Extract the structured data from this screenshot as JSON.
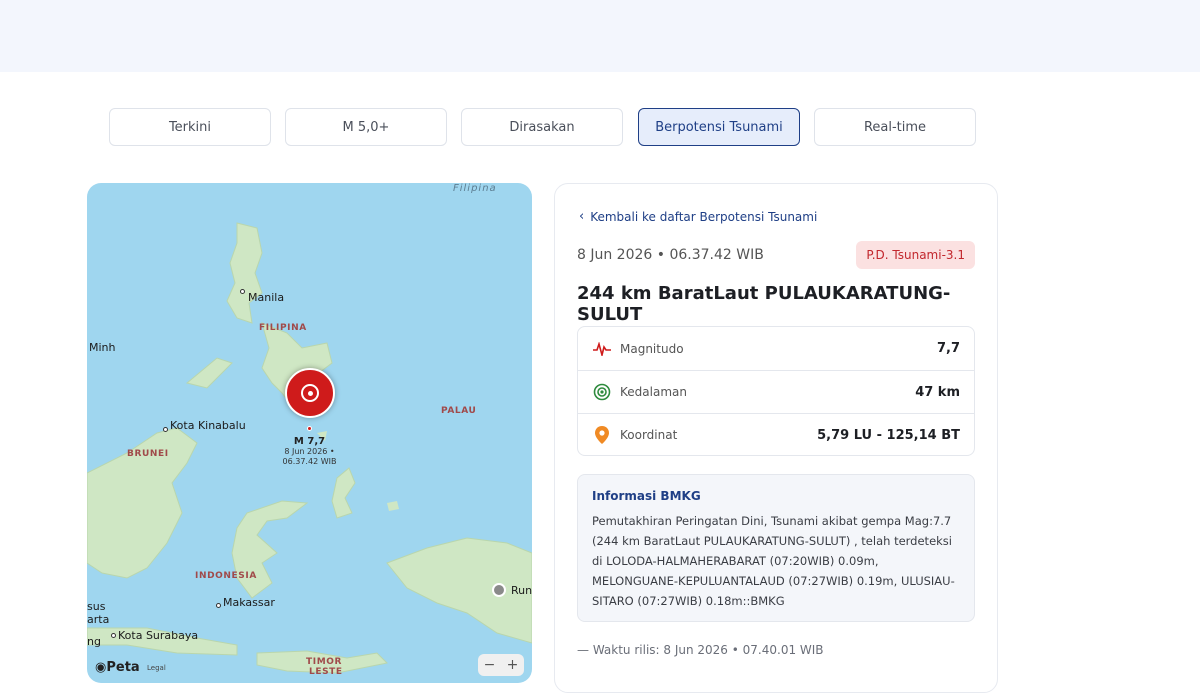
{
  "tabs": [
    {
      "label": "Terkini",
      "active": false
    },
    {
      "label": "M 5,0+",
      "active": false
    },
    {
      "label": "Dirasakan",
      "active": false
    },
    {
      "label": "Berpotensi Tsunami",
      "active": true
    },
    {
      "label": "Real-time",
      "active": false
    }
  ],
  "map": {
    "labels": {
      "filipina_sea": "Filipina",
      "manila": "Manila",
      "filipina": "FILIPINA",
      "minh": "Minh",
      "palau": "PALAU",
      "kota_kinabalu": "Kota Kinabalu",
      "brunei": "BRUNEI",
      "indonesia": "INDONESIA",
      "makassar": "Makassar",
      "kota_surabaya": "Kota Surabaya",
      "sus": "sus",
      "arta": "arta",
      "ng": "ng",
      "timor_leste_1": "TIMOR",
      "timor_leste_2": "LESTE",
      "rund": "Rund"
    },
    "quake_marker": {
      "magnitude": "M 7,7",
      "time_line1": "8 Jun 2026 •",
      "time_line2": "06.37.42 WIB",
      "icon": "epicenter-icon"
    },
    "zoom_minus": "−",
    "zoom_plus": "+",
    "attribution": "Peta",
    "legal": "Legal"
  },
  "detail": {
    "back_label": "Kembali ke daftar Berpotensi Tsunami",
    "datetime": "8 Jun 2026 • 06.37.42 WIB",
    "badge": "P.D. Tsunami-3.1",
    "title": "244 km BaratLaut PULAUKARATUNG-SULUT",
    "params": [
      {
        "label": "Magnitudo",
        "value": "7,7",
        "icon": "seismograph-icon"
      },
      {
        "label": "Kedalaman",
        "value": "47 km",
        "icon": "depth-target-icon"
      },
      {
        "label": "Koordinat",
        "value": "5,79 LU - 125,14 BT",
        "icon": "location-pin-icon"
      }
    ],
    "info_heading": "Informasi BMKG",
    "info_body": "Pemutakhiran Peringatan Dini, Tsunami akibat gempa Mag:7.7 (244 km BaratLaut PULAUKARATUNG-SULUT) , telah terdeteksi di LOLODA-HALMAHERABARAT (07:20WIB) 0.09m, MELONGUANE-KEPULUANTALAUD (07:27WIB) 0.19m, ULUSIAU-SITARO (07:27WIB) 0.18m::BMKG",
    "release": "— Waktu rilis: 8 Jun 2026 • 07.40.01 WIB"
  },
  "colors": {
    "accent": "#1f3f86",
    "quake": "#cf1b1b",
    "badge_bg": "#fbe1e1",
    "badge_text": "#c2272d",
    "sea": "#9fd6ef",
    "land": "#cfe7c4"
  }
}
